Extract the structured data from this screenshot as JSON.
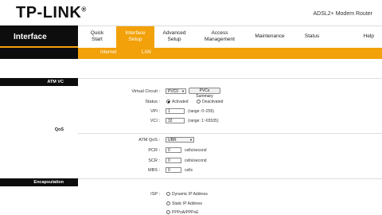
{
  "brand": {
    "logo": "TP-LINK",
    "model": "ADSL2+ Modem Router"
  },
  "nav": {
    "section": "Interface",
    "tabs": [
      {
        "line1": "Quick",
        "line2": "Start"
      },
      {
        "line1": "Interface",
        "line2": "Setup",
        "active": true
      },
      {
        "line1": "Advanced",
        "line2": "Setup"
      },
      {
        "line1": "Access",
        "line2": "Management"
      },
      {
        "line1": "Maintenance",
        "line2": ""
      },
      {
        "line1": "Status",
        "line2": ""
      },
      {
        "line1": "Help",
        "line2": ""
      }
    ],
    "subtabs": [
      "Internet",
      "LAN"
    ]
  },
  "atm": {
    "section_title": "ATM VC",
    "virtual_circuit_label": "Virtual Circuit :",
    "virtual_circuit_value": "PVC0",
    "pvcs_summary_button": "PVCs Summary",
    "status_label": "Status :",
    "status_activated": "Activated",
    "status_deactivated": "Deactivated",
    "vpi_label": "VPI :",
    "vpi_value": "1",
    "vpi_range": "(range: 0~255)",
    "vci_label": "VCI :",
    "vci_value": "32",
    "vci_range": "(range: 1~65535)"
  },
  "qos": {
    "section_title": "QoS",
    "atm_qos_label": "ATM QoS :",
    "atm_qos_value": "UBR",
    "pcr_label": "PCR :",
    "pcr_value": "0",
    "pcr_unit": "cells/second",
    "scr_label": "SCR :",
    "scr_value": "0",
    "scr_unit": "cells/second",
    "mbs_label": "MBS :",
    "mbs_value": "0",
    "mbs_unit": "cells"
  },
  "encap": {
    "section_title": "Encapsulation",
    "isp_label": "ISP :",
    "options": [
      "Dynamic IP Address",
      "Static IP Address",
      "PPPoA/PPPoE"
    ]
  },
  "colors": {
    "accent": "#f2a10a",
    "dark": "#0d0d0d"
  }
}
